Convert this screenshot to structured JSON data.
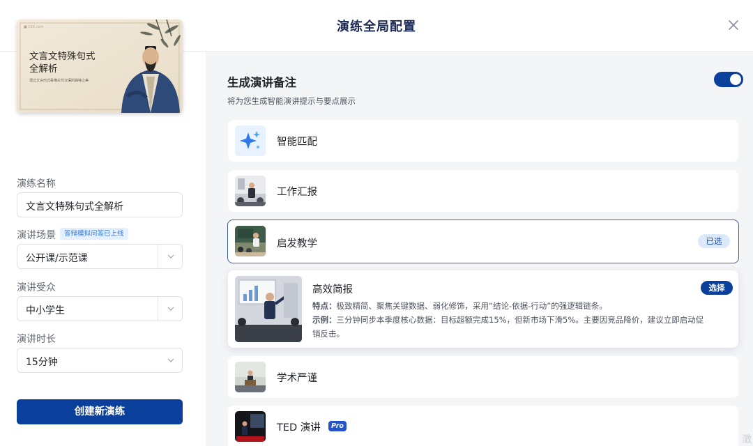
{
  "header": {
    "title": "演练全局配置"
  },
  "cover": {
    "title_line1": "文言文特殊句式",
    "title_line2": "全解析",
    "subtitle": "透过文言形式看懂古代汉语的独特之美",
    "logo_text": "■ CEK.com"
  },
  "form": {
    "name_label": "演练名称",
    "name_value": "文言文特殊句式全解析",
    "scene_label": "演讲场景",
    "scene_badge": "答辩模拟问答已上线",
    "scene_value": "公开课/示范课",
    "audience_label": "演讲受众",
    "audience_value": "中小学生",
    "duration_label": "演讲时长",
    "duration_value": "15分钟"
  },
  "create_button": "创建新演练",
  "notes": {
    "title": "生成演讲备注",
    "description": "将为您生成智能演讲提示与要点展示",
    "toggle_on": true
  },
  "styles": [
    {
      "label": "智能匹配",
      "icon": "sparkle-icon"
    },
    {
      "label": "工作汇报",
      "icon": "presenter-photo"
    },
    {
      "label": "启发教学",
      "icon": "classroom-photo",
      "badge": "已选"
    },
    {
      "label": "高效简报",
      "icon": "meeting-photo",
      "action": "选择",
      "feature_label": "特点：",
      "feature_text": "极致精简、聚焦关键数据、弱化修饰，采用“结论-依据-行动”的强逻辑链条。",
      "example_label": "示例：",
      "example_text": "三分钟同步本季度核心数据：目标超额完成15%，但新市场下滑5%。主要因竞品降价，建议立即启动促销反击。"
    },
    {
      "label": "学术严谨",
      "icon": "lecture-photo"
    },
    {
      "label": "TED 演讲",
      "icon": "ted-stage-photo",
      "badge": "Pro"
    }
  ],
  "corner_mark": "澂",
  "colors": {
    "primary": "#0a3f9c",
    "selected_border": "#3c5fb0",
    "badge_bg": "#dce9fb"
  }
}
